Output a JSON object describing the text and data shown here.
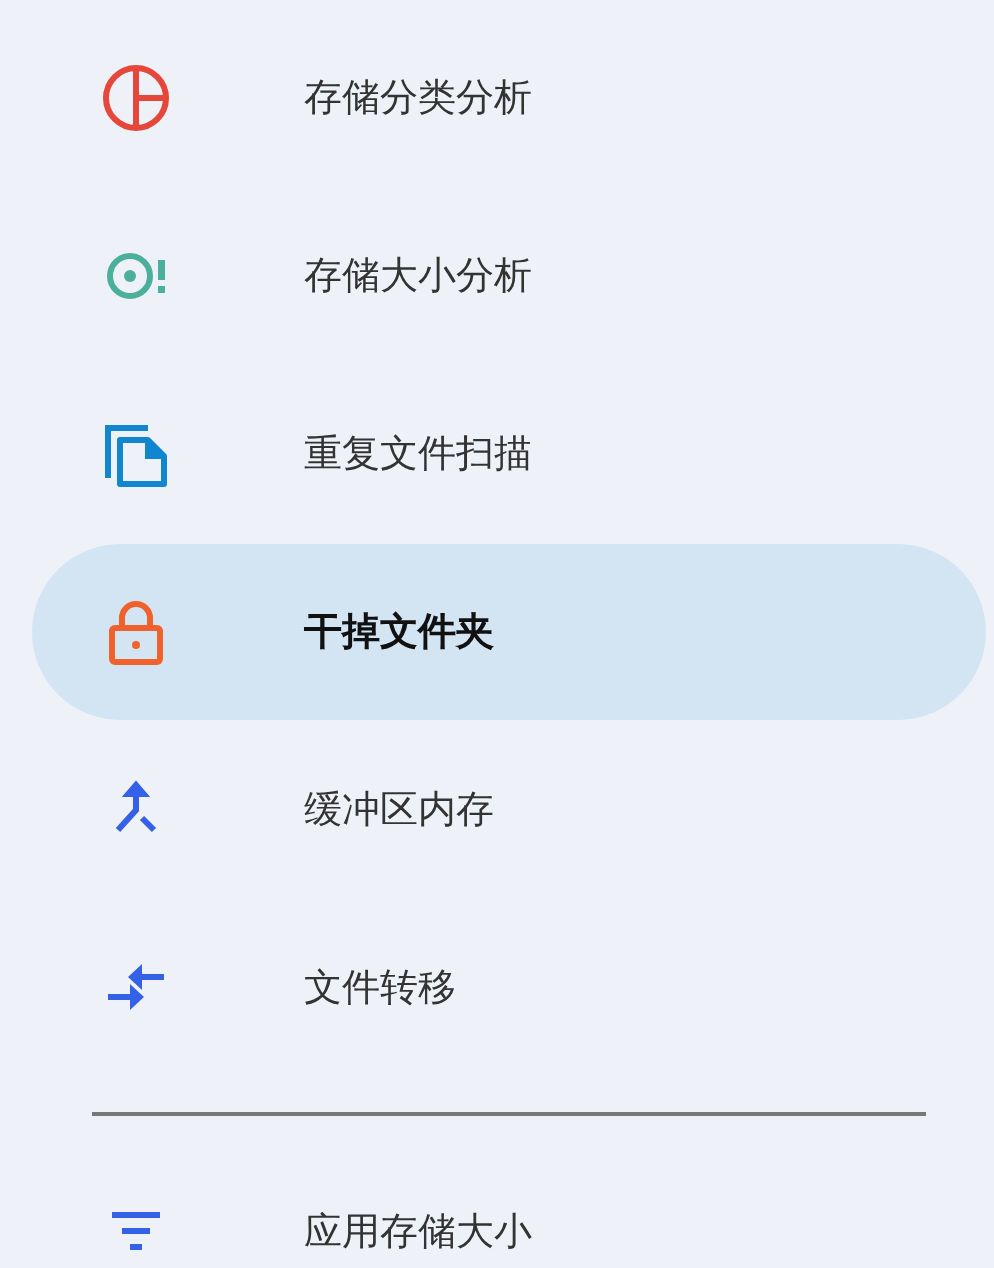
{
  "menu_sections": [
    {
      "items": [
        {
          "kind": "pie",
          "label": "存储分类分析",
          "selected": false
        },
        {
          "kind": "target",
          "label": "存储大小分析",
          "selected": false
        },
        {
          "kind": "copy",
          "label": "重复文件扫描",
          "selected": false
        },
        {
          "kind": "lock",
          "label": "干掉文件夹",
          "selected": true
        },
        {
          "kind": "merge",
          "label": "缓冲区内存",
          "selected": false
        },
        {
          "kind": "swap",
          "label": "文件转移",
          "selected": false
        }
      ]
    },
    {
      "items": [
        {
          "kind": "filter",
          "label": "应用存储大小",
          "selected": false
        }
      ]
    }
  ]
}
